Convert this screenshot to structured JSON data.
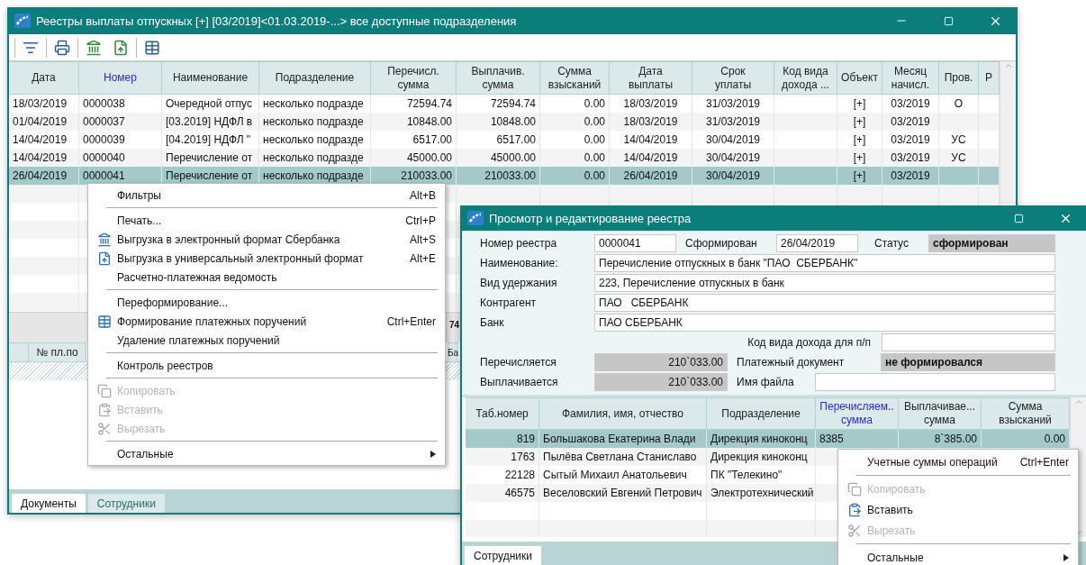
{
  "main_window": {
    "title": "Реестры выплаты отпускных [+] [03/2019]<01.03.2019-...> все доступные подразделения",
    "table": {
      "columns": [
        {
          "label": "Дата",
          "sorted": false
        },
        {
          "label": "Номер",
          "sorted": true
        },
        {
          "label": "Наименование",
          "sorted": false
        },
        {
          "label": "Подразделение",
          "sorted": false
        },
        {
          "label": "Перечисл.\nсумма",
          "sorted": false
        },
        {
          "label": "Выплачив.\nсумма",
          "sorted": false
        },
        {
          "label": "Сумма\nвзысканий",
          "sorted": false
        },
        {
          "label": "Дата\nвыплаты",
          "sorted": false
        },
        {
          "label": "Срок\nуплаты",
          "sorted": false
        },
        {
          "label": "Код вида\nдохода ...",
          "sorted": false
        },
        {
          "label": "Объект",
          "sorted": false
        },
        {
          "label": "Месяц\nначисл.",
          "sorted": false
        },
        {
          "label": "Пров.",
          "sorted": false
        },
        {
          "label": "Р",
          "sorted": false
        }
      ],
      "rows": [
        {
          "selected": false,
          "cells": [
            "18/03/2019",
            "0000038",
            "Очередной отпус",
            "несколько подразде",
            "72594.74",
            "72594.74",
            "0.00",
            "18/03/2019",
            "31/03/2019",
            "",
            "[+]",
            "03/2019",
            "О",
            ""
          ]
        },
        {
          "selected": false,
          "cells": [
            "01/04/2019",
            "0000037",
            "[03.2019] НДФЛ в",
            "несколько подразде",
            "10848.00",
            "10848.00",
            "0.00",
            "18/03/2019",
            "31/03/2019",
            "",
            "[+]",
            "03/2019",
            "",
            ""
          ]
        },
        {
          "selected": false,
          "cells": [
            "14/04/2019",
            "0000039",
            "[04.2019] НДФЛ \"",
            "несколько подразде",
            "6517.00",
            "6517.00",
            "0.00",
            "14/04/2019",
            "30/04/2019",
            "",
            "[+]",
            "03/2019",
            "УС",
            ""
          ]
        },
        {
          "selected": false,
          "cells": [
            "14/04/2019",
            "0000040",
            "Перечисление от",
            "несколько подразде",
            "45000.00",
            "45000.00",
            "0.00",
            "14/04/2019",
            "30/04/2019",
            "",
            "[+]",
            "03/2019",
            "УС",
            ""
          ]
        },
        {
          "selected": true,
          "cells": [
            "26/04/2019",
            "0000041",
            "Перечисление от",
            "несколько подразде",
            "210033.00",
            "210033.00",
            "0.00",
            "26/04/2019",
            "30/04/2019",
            "",
            "[+]",
            "03/2019",
            "",
            ""
          ]
        }
      ],
      "summary": "74"
    },
    "lower_table": {
      "columns": [
        "№ пл.по",
        "Ба"
      ]
    },
    "tabs": [
      {
        "label": "Документы",
        "selected": true
      },
      {
        "label": "Сотрудники",
        "selected": false
      }
    ]
  },
  "context_menu": {
    "items": [
      {
        "kind": "command",
        "label": "Фильтры",
        "shortcut": "Alt+B",
        "disabled": false
      },
      {
        "kind": "separator"
      },
      {
        "kind": "command",
        "label": "Печать...",
        "shortcut": "Ctrl+P",
        "disabled": false
      },
      {
        "kind": "command",
        "label": "Выгрузка в электронный формат Сбербанка",
        "shortcut": "Alt+S",
        "disabled": false
      },
      {
        "kind": "command",
        "label": "Выгрузка в универсальный электронный формат",
        "shortcut": "Alt+E",
        "disabled": false
      },
      {
        "kind": "command",
        "label": "Расчетно-платежная ведомость",
        "disabled": false
      },
      {
        "kind": "separator"
      },
      {
        "kind": "command",
        "label": "Переформирование...",
        "disabled": false
      },
      {
        "kind": "command",
        "label": "Формирование платежных поручений",
        "shortcut": "Ctrl+Enter",
        "disabled": false
      },
      {
        "kind": "command",
        "label": "Удаление платежных поручений",
        "disabled": false
      },
      {
        "kind": "separator"
      },
      {
        "kind": "command",
        "label": "Контроль реестров",
        "disabled": false
      },
      {
        "kind": "separator"
      },
      {
        "kind": "command",
        "label": "Копировать",
        "disabled": true
      },
      {
        "kind": "command",
        "label": "Вставить",
        "disabled": true
      },
      {
        "kind": "command",
        "label": "Вырезать",
        "disabled": true
      },
      {
        "kind": "separator"
      },
      {
        "kind": "submenu",
        "label": "Остальные",
        "disabled": false
      }
    ]
  },
  "edit_window": {
    "title": "Просмотр и редактирование реестра",
    "form": {
      "registry_number": {
        "label": "Номер реестра",
        "value": "0000041"
      },
      "formed": {
        "label": "Сформирован",
        "value": "26/04/2019"
      },
      "status": {
        "label": "Статус",
        "value": "сформирован"
      },
      "name": {
        "label": "Наименование:",
        "value": "Перечисление отпускных в банк \"ПАО  СБЕРБАНК\""
      },
      "deduction_type": {
        "label": "Вид удержания",
        "value": "223, Перечисление отпускных в банк"
      },
      "counterparty": {
        "label": "Контрагент",
        "value": "ПАО   СБЕРБАНК"
      },
      "bank": {
        "label": "Банк",
        "value": "ПАО СБЕРБАНК"
      },
      "income_code": {
        "label": "Код вида дохода для п/п"
      },
      "transferred": {
        "label": "Перечисляется",
        "value": "210`033.00"
      },
      "payment_document": {
        "label": "Платежный документ",
        "value": "не формировался"
      },
      "paid": {
        "label": "Выплачивается",
        "value": "210`033.00"
      },
      "file_name": {
        "label": "Имя файла"
      }
    },
    "table": {
      "columns": [
        {
          "label": "Таб.номер",
          "sorted": false
        },
        {
          "label": "Фамилия, имя, отчество",
          "sorted": false
        },
        {
          "label": "Подразделение",
          "sorted": false
        },
        {
          "label": "Перечисляем..\nсумма",
          "sorted": true
        },
        {
          "label": "Выплачивае...\nсумма",
          "sorted": false
        },
        {
          "label": "Сумма\nвзысканий",
          "sorted": false
        }
      ],
      "rows": [
        {
          "selected": true,
          "cells": [
            "819",
            "Большакова Екатерина Влади",
            "Дирекция киноконц",
            "8385",
            "8`385.00",
            "0.00"
          ]
        },
        {
          "selected": false,
          "cells": [
            "1763",
            "Пылёва Светлана Станиславо",
            "Дирекция киноконц",
            "",
            "",
            ""
          ]
        },
        {
          "selected": false,
          "cells": [
            "22128",
            "Сытый Михаил Анатольевич",
            "ПК \"Телекино\"",
            "",
            "",
            ""
          ]
        },
        {
          "selected": false,
          "cells": [
            "46575",
            "Веселовский Евгений Петрович",
            "Электротехнический",
            "",
            "",
            ""
          ]
        }
      ]
    },
    "tabs": [
      {
        "label": "Сотрудники",
        "selected": true
      }
    ]
  },
  "row_menu": {
    "items": [
      {
        "kind": "command",
        "label": "Учетные суммы операций",
        "shortcut": "Ctrl+Enter",
        "disabled": false
      },
      {
        "kind": "separator"
      },
      {
        "kind": "command",
        "label": "Копировать",
        "disabled": true
      },
      {
        "kind": "command",
        "label": "Вставить",
        "disabled": false
      },
      {
        "kind": "command",
        "label": "Вырезать",
        "disabled": true
      },
      {
        "kind": "separator"
      },
      {
        "kind": "submenu",
        "label": "Остальные",
        "disabled": false
      }
    ]
  }
}
